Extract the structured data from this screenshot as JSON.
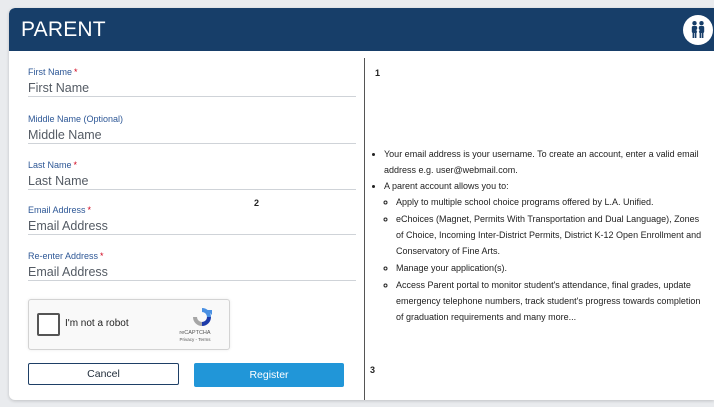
{
  "header": {
    "title": "PARENT",
    "icon": "family-icon"
  },
  "form": {
    "fields": [
      {
        "label": "First Name",
        "required": "*",
        "placeholder": "First Name"
      },
      {
        "label": "Middle Name (Optional)",
        "required": "",
        "placeholder": "Middle Name"
      },
      {
        "label": "Last Name",
        "required": "*",
        "placeholder": "Last Name"
      },
      {
        "label": "Email Address",
        "required": "*",
        "placeholder": "Email Address"
      },
      {
        "label": "Re-enter Address",
        "required": "*",
        "placeholder": "Email Address"
      }
    ],
    "recaptcha": {
      "label": "I'm not a robot",
      "brand": "reCAPTCHA",
      "terms": "Privacy - Terms"
    },
    "buttons": {
      "cancel": "Cancel",
      "register": "Register"
    }
  },
  "markers": [
    "1",
    "2",
    "3"
  ],
  "info": {
    "bullet1": "Your email address is your username. To create an account, enter a valid email address e.g. user@webmail.com.",
    "bullet2": "A parent account allows you to:",
    "subitems": [
      "Apply to multiple school choice programs offered by L.A. Unified.",
      "eChoices (Magnet, Permits With Transportation and Dual Language), Zones of Choice, Incoming Inter-District Permits, District K-12 Open Enrollment and Conservatory of Fine Arts.",
      "Manage your application(s).",
      "Access Parent portal to monitor student's attendance, final grades, update emergency telephone numbers, track student's progress towards completion of graduation requirements and many more..."
    ]
  },
  "colors": {
    "header": "#173e69",
    "label": "#2d5796",
    "required": "#d0021b",
    "register": "#2196d8",
    "cancel_border": "#1e3f66"
  }
}
